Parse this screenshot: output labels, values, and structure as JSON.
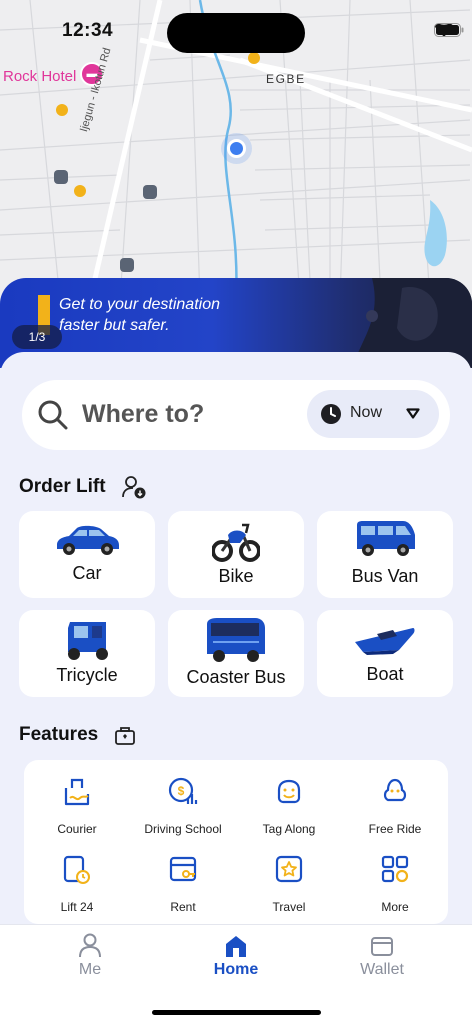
{
  "status_bar": {
    "time": "12:34"
  },
  "map": {
    "hotel_label": "Rock Hotel",
    "area_label": "EGBE",
    "road_label": "Ijegun - Ikotun Rd"
  },
  "banner": {
    "text_line1": "Get to your destination",
    "text_line2": "faster but safer.",
    "pager": "1/3"
  },
  "search": {
    "placeholder": "Where to?",
    "time_option": "Now"
  },
  "order_lift": {
    "title": "Order Lift",
    "options": [
      {
        "label": "Car",
        "icon": "car-icon"
      },
      {
        "label": "Bike",
        "icon": "bike-icon"
      },
      {
        "label": "Bus Van",
        "icon": "bus-van-icon"
      },
      {
        "label": "Tricycle",
        "icon": "tricycle-icon"
      },
      {
        "label": "Coaster Bus",
        "icon": "coaster-bus-icon"
      },
      {
        "label": "Boat",
        "icon": "boat-icon"
      }
    ]
  },
  "features": {
    "title": "Features",
    "items": [
      {
        "label": "Courier",
        "icon": "courier-icon"
      },
      {
        "label": "Driving School",
        "icon": "driving-school-icon"
      },
      {
        "label": "Tag Along",
        "icon": "tag-along-icon"
      },
      {
        "label": "Free Ride",
        "icon": "free-ride-icon"
      },
      {
        "label": "Lift 24",
        "icon": "lift-24-icon"
      },
      {
        "label": "Rent",
        "icon": "rent-icon"
      },
      {
        "label": "Travel",
        "icon": "travel-icon"
      },
      {
        "label": "More",
        "icon": "more-icon"
      }
    ]
  },
  "tabbar": {
    "tabs": [
      {
        "label": "Me",
        "icon": "person-icon",
        "active": false
      },
      {
        "label": "Home",
        "icon": "home-icon",
        "active": true
      },
      {
        "label": "Wallet",
        "icon": "wallet-icon",
        "active": false
      }
    ]
  },
  "colors": {
    "brand_blue": "#1a4fc4",
    "accent_yellow": "#f2b21a",
    "inactive_gray": "#8a8f9c"
  }
}
